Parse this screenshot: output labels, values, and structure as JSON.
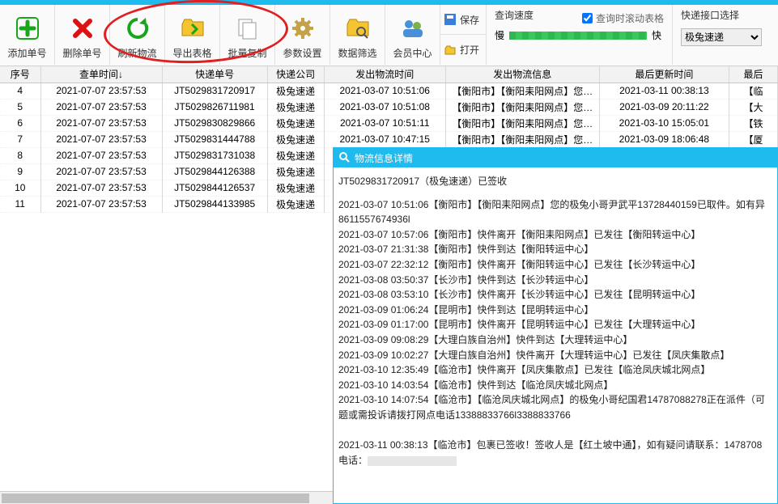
{
  "toolbar": {
    "add": "添加单号",
    "del": "删除单号",
    "refresh": "刷新物流",
    "export": "导出表格",
    "batch": "批量复制",
    "settings": "参数设置",
    "filter": "数据筛选",
    "member": "会员中心",
    "save": "保存",
    "open": "打开"
  },
  "speed": {
    "title": "查询速度",
    "check": "查询时滚动表格",
    "slow": "慢",
    "fast": "快"
  },
  "iface": {
    "title": "快递接口选择",
    "value": "极兔速递"
  },
  "cols": [
    "序号",
    "查单时间↓",
    "快递单号",
    "快递公司",
    "发出物流时间",
    "发出物流信息",
    "最后更新时间",
    "最后"
  ],
  "rows": [
    {
      "n": "4",
      "t": "2021-07-07 23:57:53",
      "code": "JT5029831720917",
      "co": "极兔速递",
      "ft": "2021-03-07 10:51:06",
      "info": "【衡阳市】【衡阳耒阳网点】您…",
      "ut": "2021-03-11 00:38:13",
      "last": "【临"
    },
    {
      "n": "5",
      "t": "2021-07-07 23:57:53",
      "code": "JT5029826711981",
      "co": "极兔速递",
      "ft": "2021-03-07 10:51:08",
      "info": "【衡阳市】【衡阳耒阳网点】您…",
      "ut": "2021-03-09 20:11:22",
      "last": "【大"
    },
    {
      "n": "6",
      "t": "2021-07-07 23:57:53",
      "code": "JT5029830829866",
      "co": "极兔速递",
      "ft": "2021-03-07 10:51:11",
      "info": "【衡阳市】【衡阳耒阳网点】您…",
      "ut": "2021-03-10 15:05:01",
      "last": "【铁"
    },
    {
      "n": "7",
      "t": "2021-07-07 23:57:53",
      "code": "JT5029831444788",
      "co": "极兔速递",
      "ft": "2021-03-07 10:47:15",
      "info": "【衡阳市】【衡阳耒阳网点】您…",
      "ut": "2021-03-09 18:06:48",
      "last": "【厦"
    },
    {
      "n": "8",
      "t": "2021-07-07 23:57:53",
      "code": "JT5029831731038",
      "co": "极兔速递",
      "ft": "",
      "info": "",
      "ut": "",
      "last": ""
    },
    {
      "n": "9",
      "t": "2021-07-07 23:57:53",
      "code": "JT5029844126388",
      "co": "极兔速递",
      "ft": "",
      "info": "",
      "ut": "",
      "last": ""
    },
    {
      "n": "10",
      "t": "2021-07-07 23:57:53",
      "code": "JT5029844126537",
      "co": "极兔速递",
      "ft": "",
      "info": "",
      "ut": "",
      "last": ""
    },
    {
      "n": "11",
      "t": "2021-07-07 23:57:53",
      "code": "JT5029844133985",
      "co": "极兔速递",
      "ft": "",
      "info": "",
      "ut": "",
      "last": ""
    }
  ],
  "detail": {
    "title": "物流信息详情",
    "sig": "JT5029831720917（极兔速递）已签收",
    "lines": [
      "2021-03-07 10:51:06【衡阳市】【衡阳耒阳网点】您的极兔小哥尹武平13728440159已取件。如有异",
      "8611557674936l",
      "2021-03-07 10:57:06【衡阳市】快件离开【衡阳耒阳网点】已发往【衡阳转运中心】",
      "2021-03-07 21:31:38【衡阳市】快件到达【衡阳转运中心】",
      "2021-03-07 22:32:12【衡阳市】快件离开【衡阳转运中心】已发往【长沙转运中心】",
      "2021-03-08 03:50:37【长沙市】快件到达【长沙转运中心】",
      "2021-03-08 03:53:10【长沙市】快件离开【长沙转运中心】已发往【昆明转运中心】",
      "2021-03-09 01:06:24【昆明市】快件到达【昆明转运中心】",
      "2021-03-09 01:17:00【昆明市】快件离开【昆明转运中心】已发往【大理转运中心】",
      "2021-03-09 09:08:29【大理白族自治州】快件到达【大理转运中心】",
      "2021-03-09 10:02:27【大理白族自治州】快件离开【大理转运中心】已发往【凤庆集散点】",
      "2021-03-10 12:35:49【临沧市】快件离开【凤庆集散点】已发往【临沧凤庆城北网点】",
      "2021-03-10 14:03:54【临沧市】快件到达【临沧凤庆城北网点】",
      "2021-03-10 14:07:54【临沧市】【临沧凤庆城北网点】的极兔小哥纪国君14787088278正在派件（可",
      "题或需投诉请拨打网点电话13388833766l3388833766",
      "",
      "2021-03-11 00:38:13【临沧市】包裹已签收！签收人是【红土坡中通】，如有疑问请联系：1478708"
    ],
    "tel_label": "电话："
  }
}
